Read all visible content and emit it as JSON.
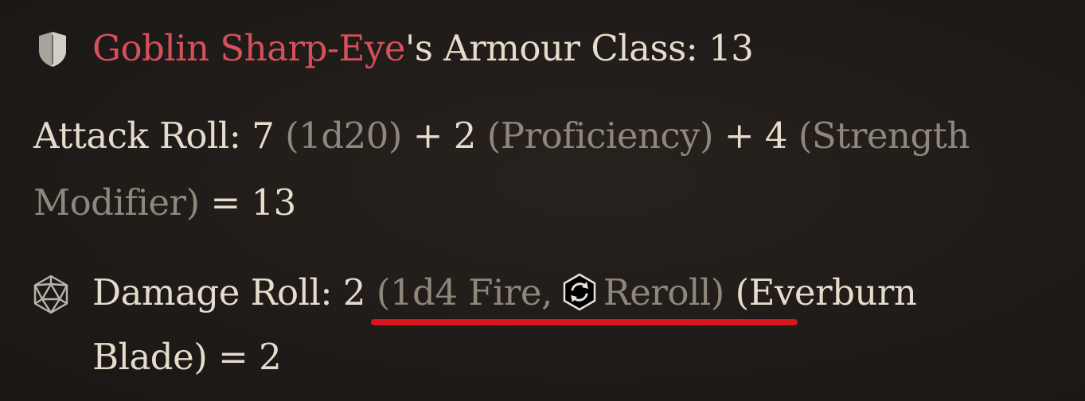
{
  "tooltip": {
    "armour_class": {
      "enemy_name": "Goblin Sharp-Eye",
      "label_suffix": "'s Armour Class: 13"
    },
    "attack_roll": {
      "label": "Attack Roll: 7",
      "dice": "(1d20)",
      "plus_prof": "+ 2",
      "prof_note": "(Proficiency)",
      "plus_str": "+ 4",
      "str_note_1": "(Strength",
      "str_note_2": "Modifier)",
      "total": "= 13"
    },
    "damage_roll": {
      "label": "Damage Roll: 2",
      "dice": "(1d4 Fire,",
      "reroll": "Reroll)",
      "source_1": "(Everburn",
      "source_2": "Blade) = 2"
    }
  },
  "colors": {
    "enemy_name": "#d4505c",
    "primary_text": "#e6dccb",
    "muted_text": "#8f877c",
    "highlight": "#d8141d"
  },
  "icons": {
    "armour_class": "shield-icon",
    "damage_roll": "d20-icon",
    "reroll": "reroll-icon"
  }
}
